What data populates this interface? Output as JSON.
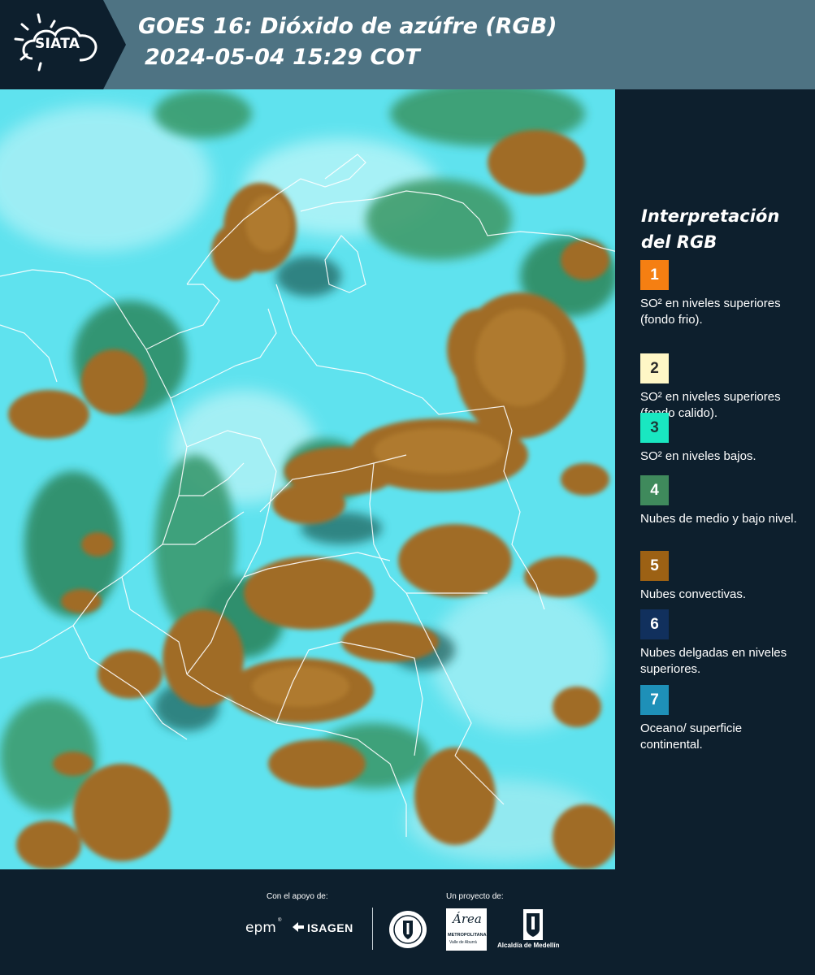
{
  "header": {
    "logo_text": "SIATA",
    "title_line1": "GOES 16: Dióxido de azúfre (RGB)",
    "title_line2": "2024-05-04 15:29 COT"
  },
  "legend": {
    "title": "Interpretación del RGB",
    "items": [
      {
        "number": "1",
        "label": "SO² en niveles superiores (fondo frio).",
        "color": "#f57f12",
        "text_color": "#ffffff"
      },
      {
        "number": "2",
        "label": "SO² en niveles superiores (fondo calido).",
        "color": "#fff7c6",
        "text_color": "#2a2a2a"
      },
      {
        "number": "3",
        "label": "SO² en niveles bajos.",
        "color": "#19e7c1",
        "text_color": "#1b3a3a"
      },
      {
        "number": "4",
        "label": "Nubes de medio y bajo nivel.",
        "color": "#3f8a5c",
        "text_color": "#ffffff"
      },
      {
        "number": "5",
        "label": "Nubes convectivas.",
        "color": "#9c6114",
        "text_color": "#ffffff"
      },
      {
        "number": "6",
        "label": "Nubes delgadas en niveles superiores.",
        "color": "#11305d",
        "text_color": "#ffffff"
      },
      {
        "number": "7",
        "label": "Oceano/ superficie continental.",
        "color": "#1e90b8",
        "text_color": "#ffffff"
      }
    ]
  },
  "footer": {
    "support_label": "Con el apoyo de:",
    "project_label": "Un proyecto de:",
    "sponsor_epm": "epm",
    "sponsor_isagen": "ISAGEN",
    "area_metropolitana": "Área",
    "area_metropolitana_sub": "METROPOLITANA",
    "area_metropolitana_sub2": "Valle de Aburrá",
    "alcaldia": "Alcaldía de Medellín"
  },
  "colors": {
    "header_bg": "#4e7383",
    "logo_bg": "#0d1f2d",
    "page_bg": "#0d1f2d",
    "cloud_cyan": "#5ee6ee",
    "convective_brown": "#9c6a25",
    "low_cloud_green": "#2f8a63"
  }
}
